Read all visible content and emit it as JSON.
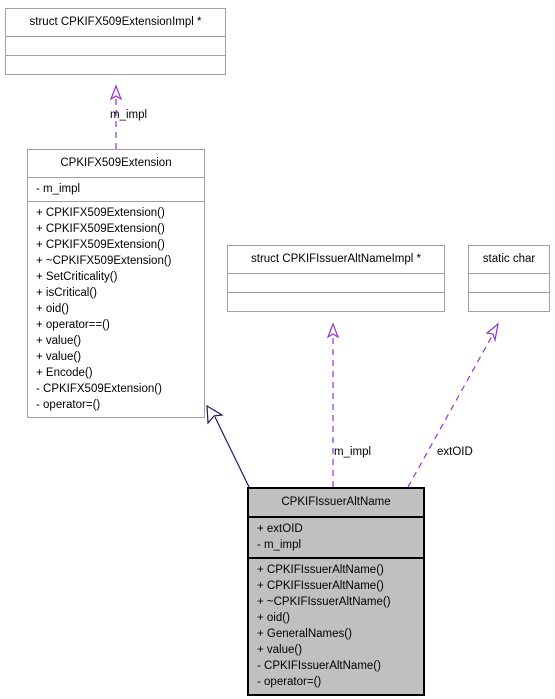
{
  "diagram": {
    "kind": "uml-class-diagram",
    "colors": {
      "background": "#ffffff",
      "box_fill": "#ffffff",
      "highlight_fill": "#c0c0c0",
      "box_border": "#a0a0a0",
      "highlight_border": "#000000",
      "aggregation_edge": "#9a32cd",
      "inheritance_edge": "#1a1a6e",
      "text": "#000000"
    }
  },
  "nodes": {
    "x509_extension_impl": {
      "title": "struct CPKIFX509ExtensionImpl *",
      "attributes": [],
      "methods": []
    },
    "x509_extension": {
      "title": "CPKIFX509Extension",
      "attributes": [
        "- m_impl"
      ],
      "methods": [
        "+ CPKIFX509Extension()",
        "+ CPKIFX509Extension()",
        "+ CPKIFX509Extension()",
        "+ ~CPKIFX509Extension()",
        "+ SetCriticality()",
        "+ isCritical()",
        "+ oid()",
        "+ operator==()",
        "+ value()",
        "+ value()",
        "+ Encode()",
        "- CPKIFX509Extension()",
        "- operator=()"
      ]
    },
    "issuer_alt_name_impl": {
      "title": "struct CPKIFIssuerAltNameImpl *",
      "attributes": [],
      "methods": []
    },
    "static_char": {
      "title": "static char",
      "attributes": [],
      "methods": []
    },
    "issuer_alt_name": {
      "title": "CPKIFIssuerAltName",
      "attributes": [
        "+ extOID",
        "- m_impl"
      ],
      "methods": [
        "+ CPKIFIssuerAltName()",
        "+ CPKIFIssuerAltName()",
        "+ ~CPKIFIssuerAltName()",
        "+ oid()",
        "+ GeneralNames()",
        "+ value()",
        "- CPKIFIssuerAltName()",
        "- operator=()"
      ]
    }
  },
  "edges": {
    "impl_to_extension": {
      "label": "m_impl",
      "style": "dashed",
      "type": "aggregation"
    },
    "impl_to_issuer_alt_name": {
      "label": "m_impl",
      "style": "dashed",
      "type": "aggregation"
    },
    "static_char_to_issuer_alt_name": {
      "label": "extOID",
      "style": "dashed",
      "type": "aggregation"
    },
    "extension_inheritance": {
      "label": "",
      "style": "solid",
      "type": "inheritance"
    }
  }
}
